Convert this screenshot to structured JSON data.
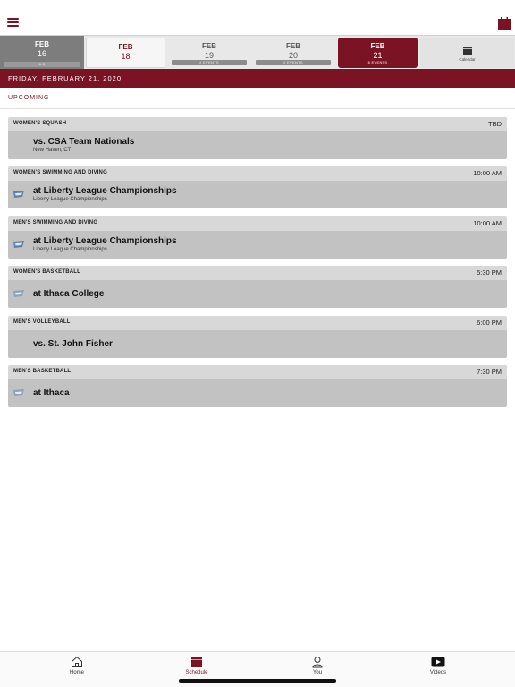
{
  "header": {
    "menu_icon": "hamburger-menu-icon",
    "calendar_icon": "calendar-icon"
  },
  "date_strip": {
    "days": [
      {
        "month": "FEB",
        "day": "16",
        "events": "6-3",
        "state": "past"
      },
      {
        "month": "FEB",
        "day": "18",
        "events": "",
        "state": "today"
      },
      {
        "month": "FEB",
        "day": "19",
        "events": "2 EVENTS",
        "state": "normal"
      },
      {
        "month": "FEB",
        "day": "20",
        "events": "2 EVENTS",
        "state": "normal"
      },
      {
        "month": "FEB",
        "day": "21",
        "events": "6 EVENTS",
        "state": "selected"
      }
    ],
    "calendar_label": "Calendar"
  },
  "banner": {
    "date": "FRIDAY, FEBRUARY 21, 2020"
  },
  "section": {
    "title": "UPCOMING"
  },
  "events": [
    {
      "sport": "WOMEN'S SQUASH",
      "time": "TBD",
      "opponent": "vs. CSA Team Nationals",
      "subtitle": "New Haven, CT",
      "logo": ""
    },
    {
      "sport": "WOMEN'S SWIMMING AND DIVING",
      "time": "10:00 AM",
      "opponent": "at Liberty League Championships",
      "subtitle": "Liberty League Championships",
      "logo": "team-logo-icon"
    },
    {
      "sport": "MEN'S SWIMMING AND DIVING",
      "time": "10:00 AM",
      "opponent": "at Liberty League Championships",
      "subtitle": "Liberty League Championships",
      "logo": "team-logo-icon"
    },
    {
      "sport": "WOMEN'S BASKETBALL",
      "time": "5:30 PM",
      "opponent": "at Ithaca College",
      "subtitle": "",
      "logo": "team-logo-icon"
    },
    {
      "sport": "MEN'S VOLLEYBALL",
      "time": "6:00 PM",
      "opponent": "vs. St. John Fisher",
      "subtitle": "",
      "logo": ""
    },
    {
      "sport": "MEN'S BASKETBALL",
      "time": "7:30 PM",
      "opponent": "at Ithaca",
      "subtitle": "",
      "logo": "team-logo-icon"
    }
  ],
  "tabbar": {
    "tabs": [
      {
        "label": "Home",
        "icon": "home-icon",
        "active": false
      },
      {
        "label": "Schedule",
        "icon": "calendar-icon",
        "active": true
      },
      {
        "label": "You",
        "icon": "person-icon",
        "active": false
      },
      {
        "label": "Videos",
        "icon": "play-icon",
        "active": false
      }
    ]
  },
  "colors": {
    "accent": "#7a1324",
    "card_header": "#d8d8d8",
    "card_body": "#c2c2c2"
  }
}
